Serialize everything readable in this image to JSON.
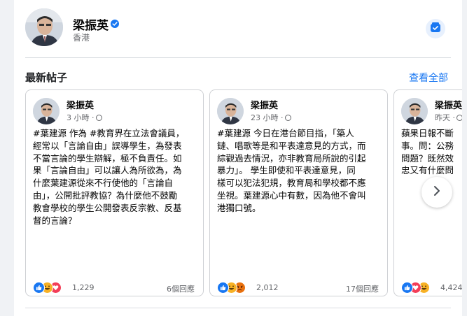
{
  "profile": {
    "name": "梁振英",
    "location": "香港"
  },
  "section": {
    "title": "最新帖子",
    "see_all": "查看全部"
  },
  "posts": [
    {
      "author": "梁振英",
      "time": "3 小時 ·",
      "text": "#葉建源 作為 #教育界在立法會議員，\n經常以「言論自由」誤導學生，為發表\n不當言論的學生辯解，極不負責任。如\n果「言論自由」可以讓人為所欲為，為\n什麼葉建源從來不行使他的「言論自\n由」，公開批評教協？為什麼他不鼓勵\n教會學校的學生公開發表反宗教、反基\n督的言論？",
      "reactions": [
        "like",
        "haha",
        "love"
      ],
      "reaction_count": "1,229",
      "comments": "6個回應"
    },
    {
      "author": "梁振英",
      "time": "23 小時 ·",
      "text": "#葉建源 今日在港台節目指，「築人\n鏈、唱歌等是和平表達意見的方式，而\n綜觀過去情況，亦非教育局所說的引起\n暴力」。 學生即使和平表達意見，同\n樣可以犯法犯規，教育局和學校都不應\n坐視。葉建源心中有數，因為他不會叫\n港獨口號。",
      "reactions": [
        "like",
        "haha",
        "angry"
      ],
      "reaction_count": "2,012",
      "comments": "17個回應"
    },
    {
      "author": "梁振英",
      "time": "昨天 ·",
      "text": "蘋果日報不斷\n事。問：公務\n問題？既然效\n忠又有什麼問",
      "reactions": [
        "like",
        "love",
        "haha"
      ],
      "reaction_count": "4,424",
      "comments": ""
    }
  ],
  "colors": {
    "accent": "#1877f2",
    "background": "#f0f2f5",
    "secondary_text": "#65676b"
  },
  "icons": {
    "verified": "verified-badge-icon",
    "messenger": "messenger-icon",
    "globe": "globe-icon",
    "next": "chevron-right-icon"
  }
}
